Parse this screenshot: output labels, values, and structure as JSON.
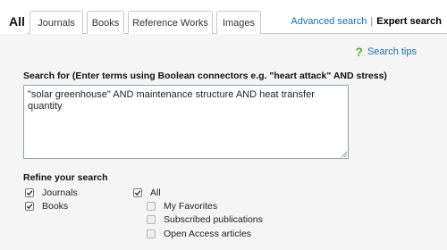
{
  "tabs": [
    {
      "label": "All",
      "active": true
    },
    {
      "label": "Journals",
      "active": false
    },
    {
      "label": "Books",
      "active": false
    },
    {
      "label": "Reference Works",
      "active": false
    },
    {
      "label": "Images",
      "active": false
    }
  ],
  "top_links": {
    "advanced": "Advanced search",
    "separator": "|",
    "expert": "Expert search"
  },
  "tips": {
    "icon": "question-icon",
    "label": "Search tips"
  },
  "search": {
    "label": "Search for  (Enter terms using Boolean connectors e.g. \"heart attack\" AND stress)",
    "value": "\"solar greenhouse\" AND maintenance structure AND heat transfer quantity"
  },
  "refine": {
    "heading": "Refine your search",
    "content_types": [
      {
        "label": "Journals",
        "checked": true
      },
      {
        "label": "Books",
        "checked": true
      }
    ],
    "scope": [
      {
        "label": "All",
        "checked": true
      },
      {
        "label": "My Favorites",
        "checked": false
      },
      {
        "label": "Subscribed publications",
        "checked": false
      },
      {
        "label": "Open Access articles",
        "checked": false
      }
    ]
  },
  "colors": {
    "link": "#1a6ea8",
    "tips_icon": "#5aa830",
    "panel_bg": "#f5f5f5"
  }
}
